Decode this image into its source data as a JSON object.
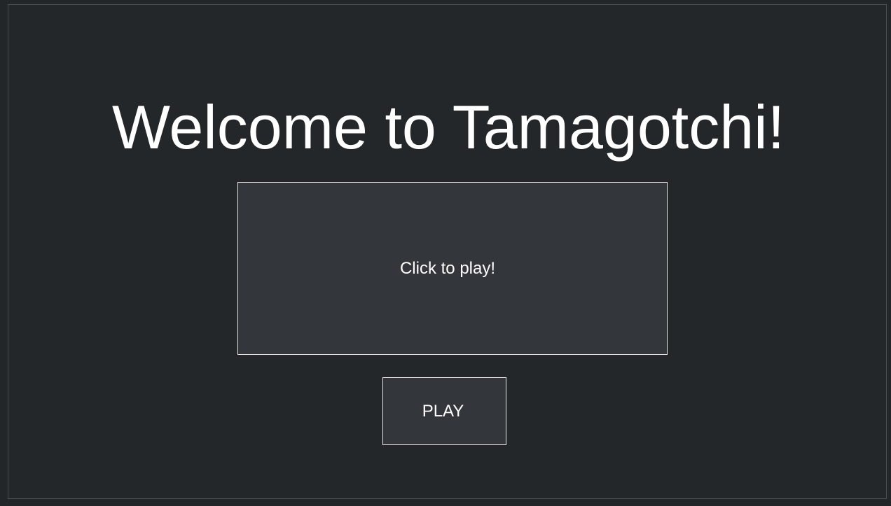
{
  "page": {
    "title": "Welcome to Tamagotchi!"
  },
  "game_screen": {
    "prompt": "Click to play!"
  },
  "controls": {
    "play_label": "PLAY"
  },
  "colors": {
    "background": "#24272a",
    "panel": "#33363a",
    "border": "#e8e8e8",
    "text": "#ffffff"
  }
}
